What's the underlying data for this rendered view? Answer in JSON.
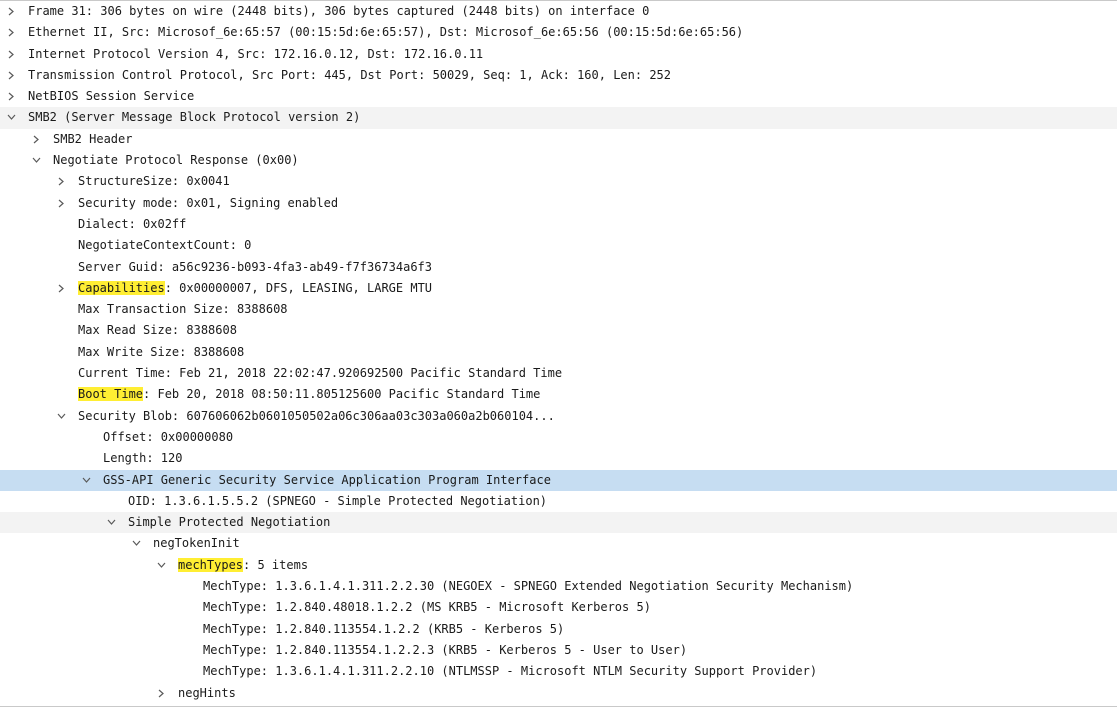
{
  "app": {
    "panel": "Packet details"
  },
  "colors": {
    "selection": "#c6ddf2",
    "highlight": "#ffee33",
    "row_subtle": "#f3f3f3",
    "text": "#1a1a1a"
  },
  "tree": [
    {
      "depth": 0,
      "toggle": "collapsed",
      "text": "Frame 31: 306 bytes on wire (2448 bits), 306 bytes captured (2448 bits) on interface 0"
    },
    {
      "depth": 0,
      "toggle": "collapsed",
      "text": "Ethernet II, Src: Microsof_6e:65:57 (00:15:5d:6e:65:57), Dst: Microsof_6e:65:56 (00:15:5d:6e:65:56)"
    },
    {
      "depth": 0,
      "toggle": "collapsed",
      "text": "Internet Protocol Version 4, Src: 172.16.0.12, Dst: 172.16.0.11"
    },
    {
      "depth": 0,
      "toggle": "collapsed",
      "text": "Transmission Control Protocol, Src Port: 445, Dst Port: 50029, Seq: 1, Ack: 160, Len: 252"
    },
    {
      "depth": 0,
      "toggle": "collapsed",
      "text": "NetBIOS Session Service"
    },
    {
      "depth": 0,
      "toggle": "expanded",
      "text": "SMB2 (Server Message Block Protocol version 2)",
      "subtle": true
    },
    {
      "depth": 1,
      "toggle": "collapsed",
      "text": "SMB2 Header"
    },
    {
      "depth": 1,
      "toggle": "expanded",
      "text": "Negotiate Protocol Response (0x00)"
    },
    {
      "depth": 2,
      "toggle": "collapsed",
      "text": "StructureSize: 0x0041"
    },
    {
      "depth": 2,
      "toggle": "collapsed",
      "text": "Security mode: 0x01, Signing enabled"
    },
    {
      "depth": 2,
      "toggle": "none",
      "text": "Dialect: 0x02ff"
    },
    {
      "depth": 2,
      "toggle": "none",
      "text": "NegotiateContextCount: 0"
    },
    {
      "depth": 2,
      "toggle": "none",
      "text": "Server Guid: a56c9236-b093-4fa3-ab49-f7f36734a6f3"
    },
    {
      "depth": 2,
      "toggle": "collapsed",
      "hl": "Capabilities",
      "rest": ": 0x00000007, DFS, LEASING, LARGE MTU"
    },
    {
      "depth": 2,
      "toggle": "none",
      "text": "Max Transaction Size: 8388608"
    },
    {
      "depth": 2,
      "toggle": "none",
      "text": "Max Read Size: 8388608"
    },
    {
      "depth": 2,
      "toggle": "none",
      "text": "Max Write Size: 8388608"
    },
    {
      "depth": 2,
      "toggle": "none",
      "text": "Current Time: Feb 21, 2018 22:02:47.920692500 Pacific Standard Time"
    },
    {
      "depth": 2,
      "toggle": "none",
      "hl": "Boot Time",
      "rest": ": Feb 20, 2018 08:50:11.805125600 Pacific Standard Time"
    },
    {
      "depth": 2,
      "toggle": "expanded",
      "text": "Security Blob: 607606062b0601050502a06c306aa03c303a060a2b060104..."
    },
    {
      "depth": 3,
      "toggle": "none",
      "text": "Offset: 0x00000080"
    },
    {
      "depth": 3,
      "toggle": "none",
      "text": "Length: 120"
    },
    {
      "depth": 3,
      "toggle": "expanded",
      "text": "GSS-API Generic Security Service Application Program Interface",
      "selected": true
    },
    {
      "depth": 4,
      "toggle": "none",
      "text": "OID: 1.3.6.1.5.5.2 (SPNEGO - Simple Protected Negotiation)"
    },
    {
      "depth": 4,
      "toggle": "expanded",
      "text": "Simple Protected Negotiation",
      "subtle": true
    },
    {
      "depth": 5,
      "toggle": "expanded",
      "text": "negTokenInit"
    },
    {
      "depth": 6,
      "toggle": "expanded",
      "hl": "mechTypes",
      "rest": ": 5 items"
    },
    {
      "depth": 7,
      "toggle": "none",
      "text": "MechType: 1.3.6.1.4.1.311.2.2.30 (NEGOEX - SPNEGO Extended Negotiation Security Mechanism)"
    },
    {
      "depth": 7,
      "toggle": "none",
      "text": "MechType: 1.2.840.48018.1.2.2 (MS KRB5 - Microsoft Kerberos 5)"
    },
    {
      "depth": 7,
      "toggle": "none",
      "text": "MechType: 1.2.840.113554.1.2.2 (KRB5 - Kerberos 5)"
    },
    {
      "depth": 7,
      "toggle": "none",
      "text": "MechType: 1.2.840.113554.1.2.2.3 (KRB5 - Kerberos 5 - User to User)"
    },
    {
      "depth": 7,
      "toggle": "none",
      "text": "MechType: 1.3.6.1.4.1.311.2.2.10 (NTLMSSP - Microsoft NTLM Security Support Provider)"
    },
    {
      "depth": 6,
      "toggle": "collapsed",
      "text": "negHints"
    }
  ]
}
